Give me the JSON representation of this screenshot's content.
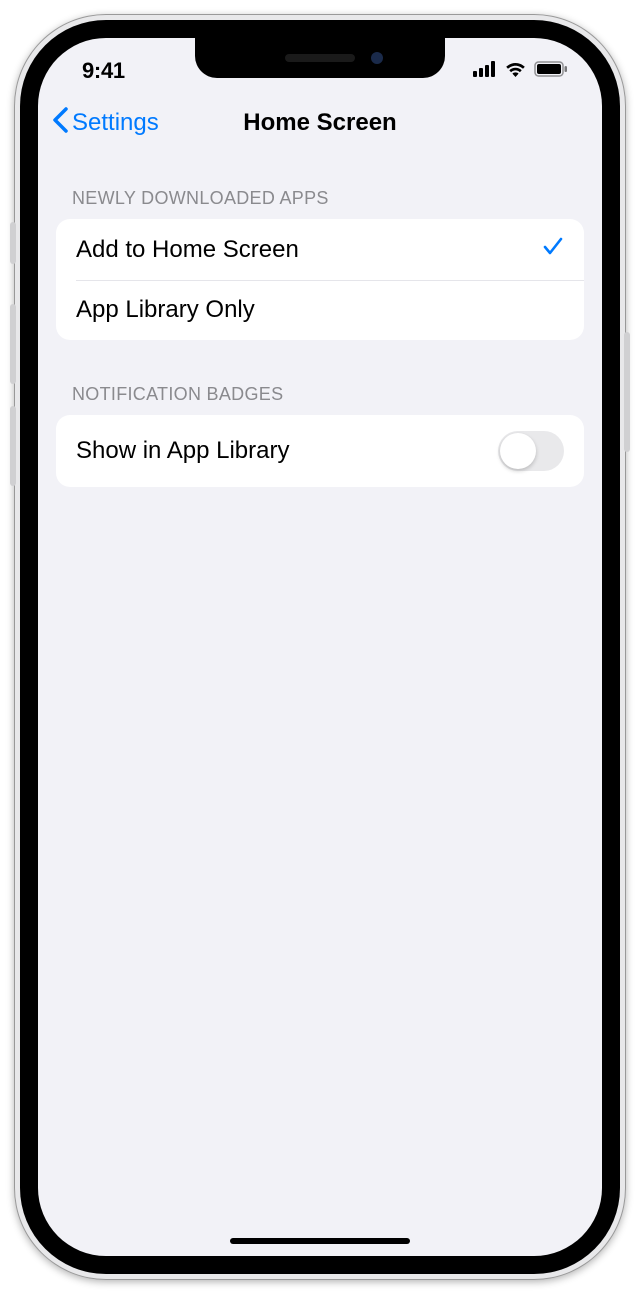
{
  "status": {
    "time": "9:41"
  },
  "nav": {
    "back_label": "Settings",
    "title": "Home Screen"
  },
  "sections": {
    "newly_downloaded": {
      "header": "NEWLY DOWNLOADED APPS",
      "options": [
        {
          "label": "Add to Home Screen",
          "selected": true
        },
        {
          "label": "App Library Only",
          "selected": false
        }
      ]
    },
    "notification_badges": {
      "header": "NOTIFICATION BADGES",
      "toggle": {
        "label": "Show in App Library",
        "enabled": false
      }
    }
  },
  "colors": {
    "accent": "#007aff",
    "background": "#f2f2f7",
    "group_bg": "#ffffff",
    "secondary_text": "#8a8a8e"
  }
}
